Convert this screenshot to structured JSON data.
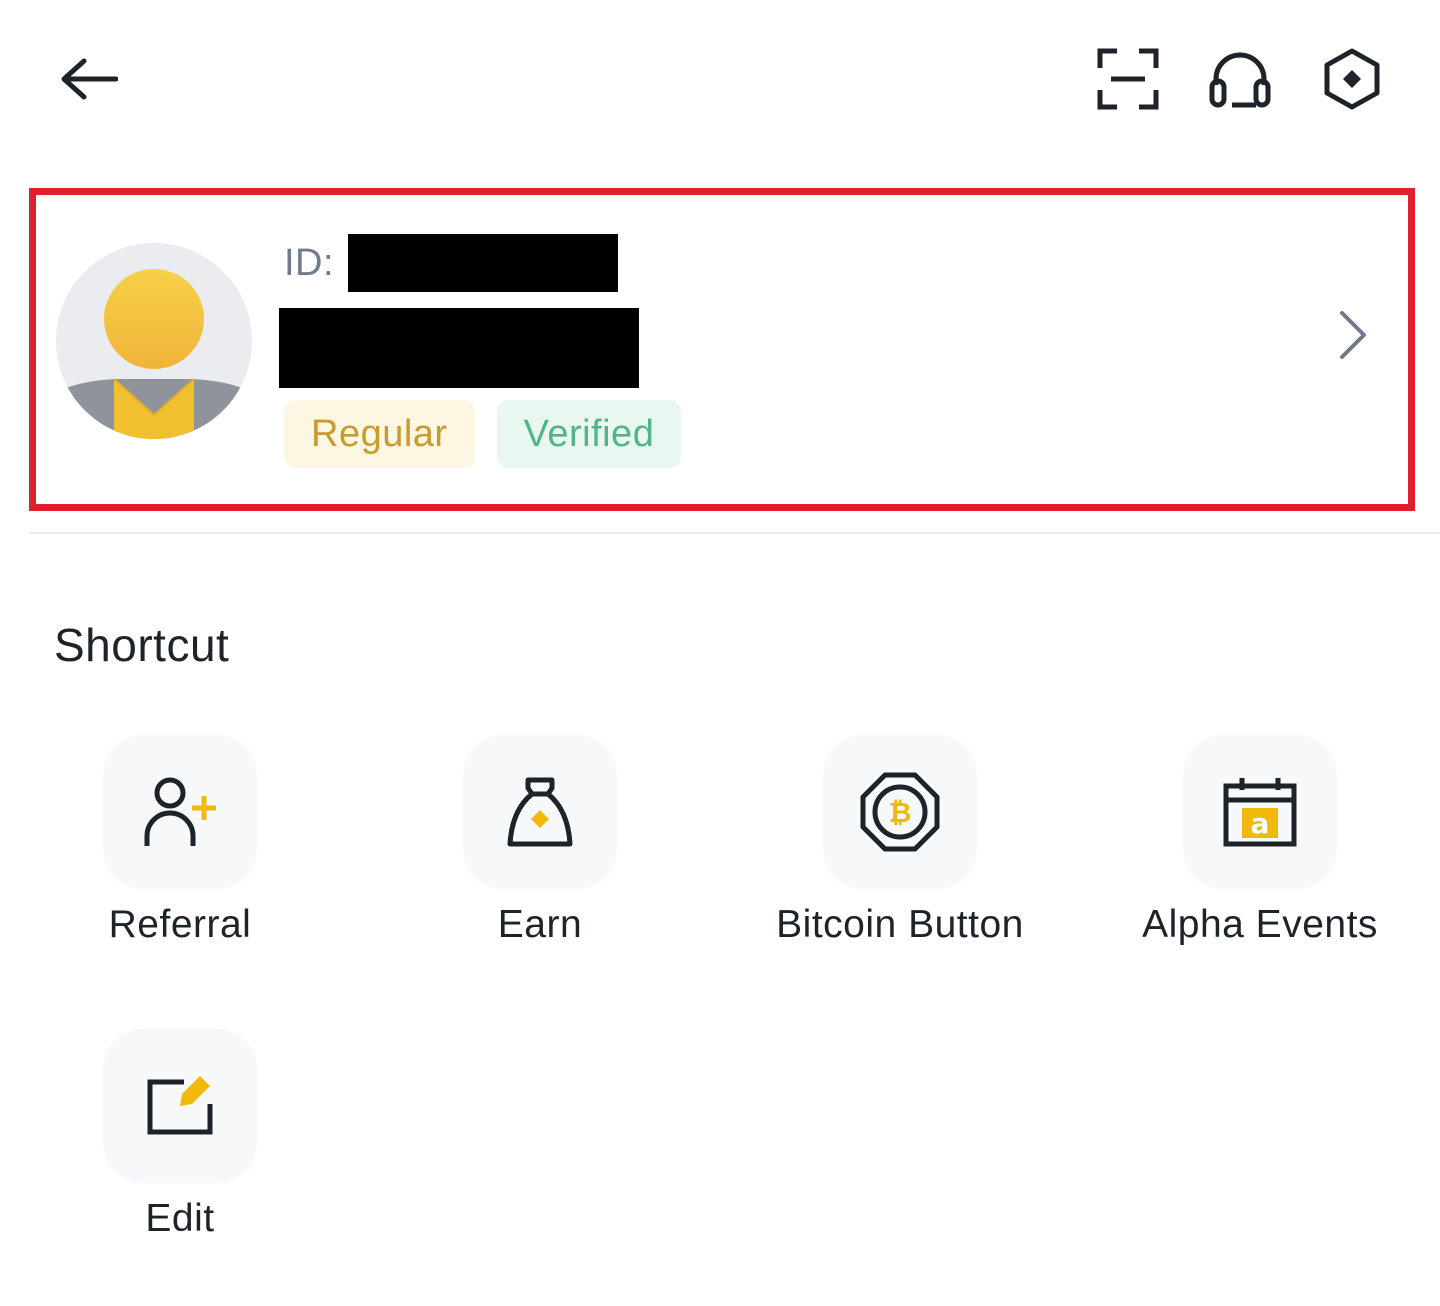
{
  "header": {
    "back_icon": "arrow-left-icon",
    "scan_icon": "scan-icon",
    "support_icon": "headset-icon",
    "binance_icon": "binance-logo-icon"
  },
  "profile": {
    "id_label": "ID:",
    "badges": [
      {
        "label": "Regular",
        "color": "#c99a2e",
        "background": "#fdf6e3"
      },
      {
        "label": "Verified",
        "color": "#50b688",
        "background": "#e9f7f0"
      }
    ],
    "highlight_color": "#e0202d"
  },
  "shortcut": {
    "title": "Shortcut",
    "items": [
      {
        "label": "Referral",
        "icon": "add-user-icon"
      },
      {
        "label": "Earn",
        "icon": "money-bag-icon"
      },
      {
        "label": "Bitcoin Button",
        "icon": "bitcoin-icon"
      },
      {
        "label": "Alpha Events",
        "icon": "calendar-alpha-icon"
      },
      {
        "label": "Edit",
        "icon": "edit-icon"
      }
    ]
  },
  "colors": {
    "accent": "#f0b90b",
    "text": "#1e2329",
    "secondary_text": "#707a8a"
  }
}
